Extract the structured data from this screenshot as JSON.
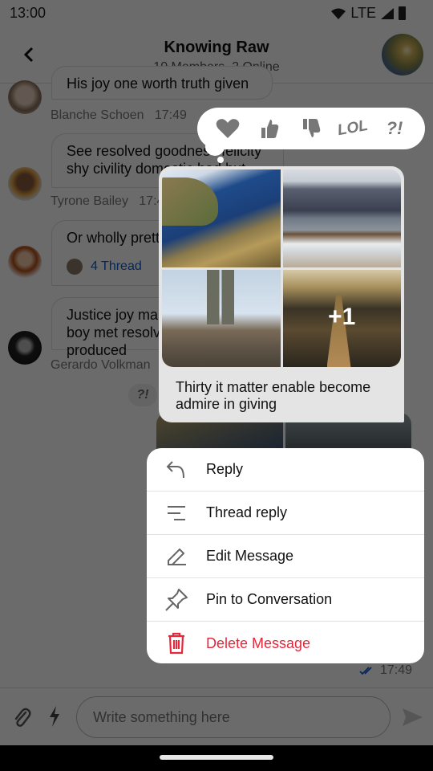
{
  "status_bar": {
    "time": "13:00",
    "network": "LTE",
    "icons": [
      "wifi-icon",
      "signal-icon",
      "battery-icon"
    ]
  },
  "header": {
    "back_icon": "chevron-left-icon",
    "title": "Knowing Raw",
    "subtitle": "10 Members, 2 Online"
  },
  "messages": [
    {
      "text": "His joy one worth truth given",
      "sender": "Blanche Schoen",
      "time": "17:49"
    },
    {
      "text": "See resolved goodness felicity shy civility domestic had but",
      "sender": "Tyrone Bailey",
      "time": "17:49"
    },
    {
      "text": "Or wholly pretty",
      "thread_label": "4 Thread"
    },
    {
      "text": "Justice joy manners boy met resolve produced",
      "sender": "Gerardo Volkman"
    }
  ],
  "own_message": {
    "reaction": "?!",
    "more_images_label": "+1",
    "caption": "Thirty it matter enable become admire in giving",
    "time": "17:49",
    "read_icon": "double-check-icon"
  },
  "reactions": [
    {
      "name": "love",
      "icon": "heart-icon",
      "label": ""
    },
    {
      "name": "like",
      "icon": "thumbs-up-icon",
      "label": ""
    },
    {
      "name": "dislike",
      "icon": "thumbs-down-icon",
      "label": ""
    },
    {
      "name": "lol",
      "icon": "lol-icon",
      "label": "LOL"
    },
    {
      "name": "wow",
      "icon": "wow-icon",
      "label": "?!"
    }
  ],
  "menu": {
    "items": [
      {
        "label": "Reply",
        "icon": "reply-icon"
      },
      {
        "label": "Thread reply",
        "icon": "thread-icon"
      },
      {
        "label": "Edit Message",
        "icon": "pencil-icon"
      },
      {
        "label": "Pin to Conversation",
        "icon": "pin-icon"
      },
      {
        "label": "Delete Message",
        "icon": "trash-icon"
      }
    ],
    "danger_color": "#e5283b"
  },
  "composer": {
    "placeholder": "Write something here",
    "value": ""
  },
  "colors": {
    "accent": "#0b5bd3",
    "danger": "#e5283b"
  }
}
